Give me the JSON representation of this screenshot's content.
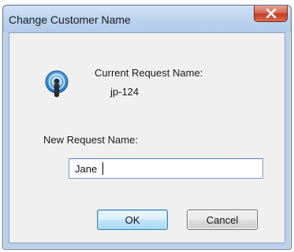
{
  "dialog": {
    "title": "Change Customer Name",
    "current_label": "Current Request Name:",
    "current_value": "jp-124",
    "new_label": "New Request Name:",
    "new_value": "Jane",
    "ok_label": "OK",
    "cancel_label": "Cancel",
    "icon": "request-broadcast-icon",
    "close_icon": "close-icon"
  },
  "colors": {
    "titlebar": "#bcd4ee",
    "close_button": "#c8432b",
    "ok_border": "#3c7fb1",
    "client_bg": "#f0f0f0"
  }
}
